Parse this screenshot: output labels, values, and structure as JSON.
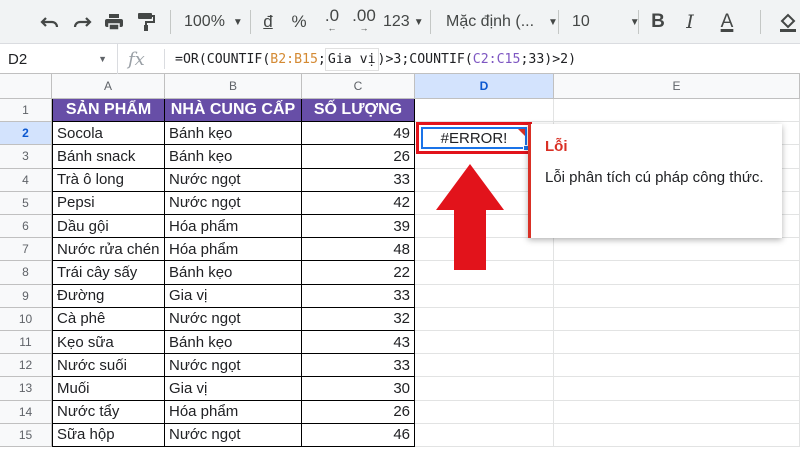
{
  "toolbar": {
    "zoom": "100%",
    "currency": "đ",
    "percent": "%",
    "dec_decrease": ".0",
    "dec_increase": ".00",
    "more_formats": "123",
    "font": "Mặc định (...",
    "font_size": "10",
    "bold": "B",
    "italic": "I",
    "text_color": "A"
  },
  "formula_bar": {
    "name_box": "D2",
    "fx": "fx",
    "formula_parts": [
      "=OR(COUNTIF(",
      "B2:B15",
      ";",
      "Gia vị",
      ")>3;COUNTIF(",
      "C2:C15",
      ";33)>2)"
    ]
  },
  "columns": [
    "A",
    "B",
    "C",
    "D",
    "E"
  ],
  "rows": [
    "1",
    "2",
    "3",
    "4",
    "5",
    "6",
    "7",
    "8",
    "9",
    "10",
    "11",
    "12",
    "13",
    "14",
    "15"
  ],
  "table": {
    "headers": [
      "SẢN PHẨM",
      "NHÀ CUNG CẤP",
      "SỐ LƯỢNG"
    ],
    "data": [
      [
        "Socola",
        "Bánh kẹo",
        "49"
      ],
      [
        "Bánh snack",
        "Bánh kẹo",
        "26"
      ],
      [
        "Trà ô long",
        "Nước ngọt",
        "33"
      ],
      [
        "Pepsi",
        "Nước ngọt",
        "42"
      ],
      [
        "Dầu gội",
        "Hóa phẩm",
        "39"
      ],
      [
        "Nước rửa chén",
        "Hóa phẩm",
        "48"
      ],
      [
        "Trái cây sấy",
        "Bánh kẹo",
        "22"
      ],
      [
        "Đường",
        "Gia vị",
        "33"
      ],
      [
        "Cà phê",
        "Nước ngọt",
        "32"
      ],
      [
        "Kẹo sữa",
        "Bánh kẹo",
        "43"
      ],
      [
        "Nước suối",
        "Nước ngọt",
        "33"
      ],
      [
        "Muối",
        "Gia vị",
        "30"
      ],
      [
        "Nước tẩy",
        "Hóa phẩm",
        "26"
      ],
      [
        "Sữa hộp",
        "Nước ngọt",
        "46"
      ]
    ]
  },
  "active_cell": {
    "value": "#ERROR!"
  },
  "error_tooltip": {
    "title": "Lỗi",
    "message": "Lỗi phân tích cú pháp công thức."
  },
  "colors": {
    "header_fill": "#674ea7",
    "arrow": "#e2131b",
    "error_red": "#d93025",
    "selection_blue": "#1a73e8"
  }
}
